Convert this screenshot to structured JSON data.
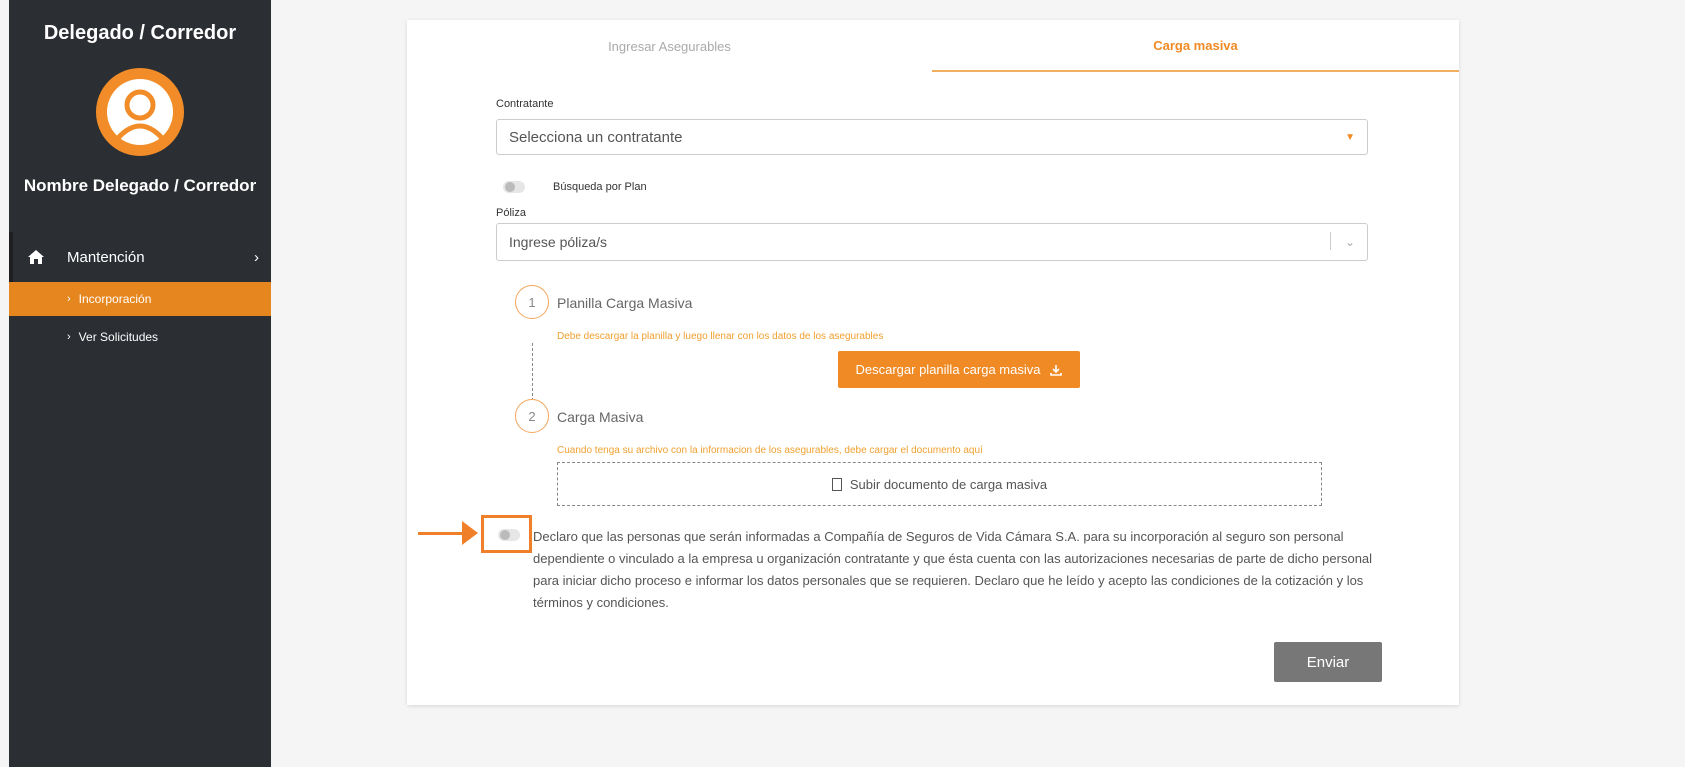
{
  "sidebar": {
    "title": "Delegado / Corredor",
    "user_name": "Nombre Delegado / Corredor",
    "menu": {
      "label": "Mantención",
      "items": [
        {
          "label": "Incorporación",
          "active": true
        },
        {
          "label": "Ver Solicitudes",
          "active": false
        }
      ]
    }
  },
  "tabs": [
    {
      "label": "Ingresar Asegurables",
      "active": false
    },
    {
      "label": "Carga masiva",
      "active": true
    }
  ],
  "form": {
    "contratante_label": "Contratante",
    "contratante_value": "Selecciona un contratante",
    "plan_toggle_label": "Búsqueda por Plan",
    "poliza_label": "Póliza",
    "poliza_placeholder": "Ingrese póliza/s"
  },
  "steps": [
    {
      "number": "1",
      "title": "Planilla Carga Masiva",
      "note": "Debe descargar la planilla y luego llenar con los datos de los asegurables",
      "button": "Descargar planilla carga masiva"
    },
    {
      "number": "2",
      "title": "Carga Masiva",
      "note": "Cuando tenga su archivo con la informacion de los asegurables, debe cargar el documento aquí",
      "button": "Subir documento de carga masiva"
    }
  ],
  "declaration": "Declaro que las personas que serán informadas a Compañía de Seguros de Vida Cámara S.A. para su incorporación al seguro son personal dependiente o vinculado a la empresa u organización contratante y que ésta cuenta con las autorizaciones necesarias de parte de dicho personal para iniciar dicho proceso e informar los datos personales que se requieren. Declaro que he leído y acepto las condiciones de la cotización y los términos y condiciones.",
  "submit_label": "Enviar",
  "colors": {
    "accent": "#f08a24",
    "sidebar_bg": "#2b2e33",
    "annotation": "#f07f2a"
  },
  "icons": [
    "user-avatar-icon",
    "home-icon",
    "chevron-right-icon",
    "download-icon",
    "file-icon",
    "chevron-down-icon"
  ]
}
